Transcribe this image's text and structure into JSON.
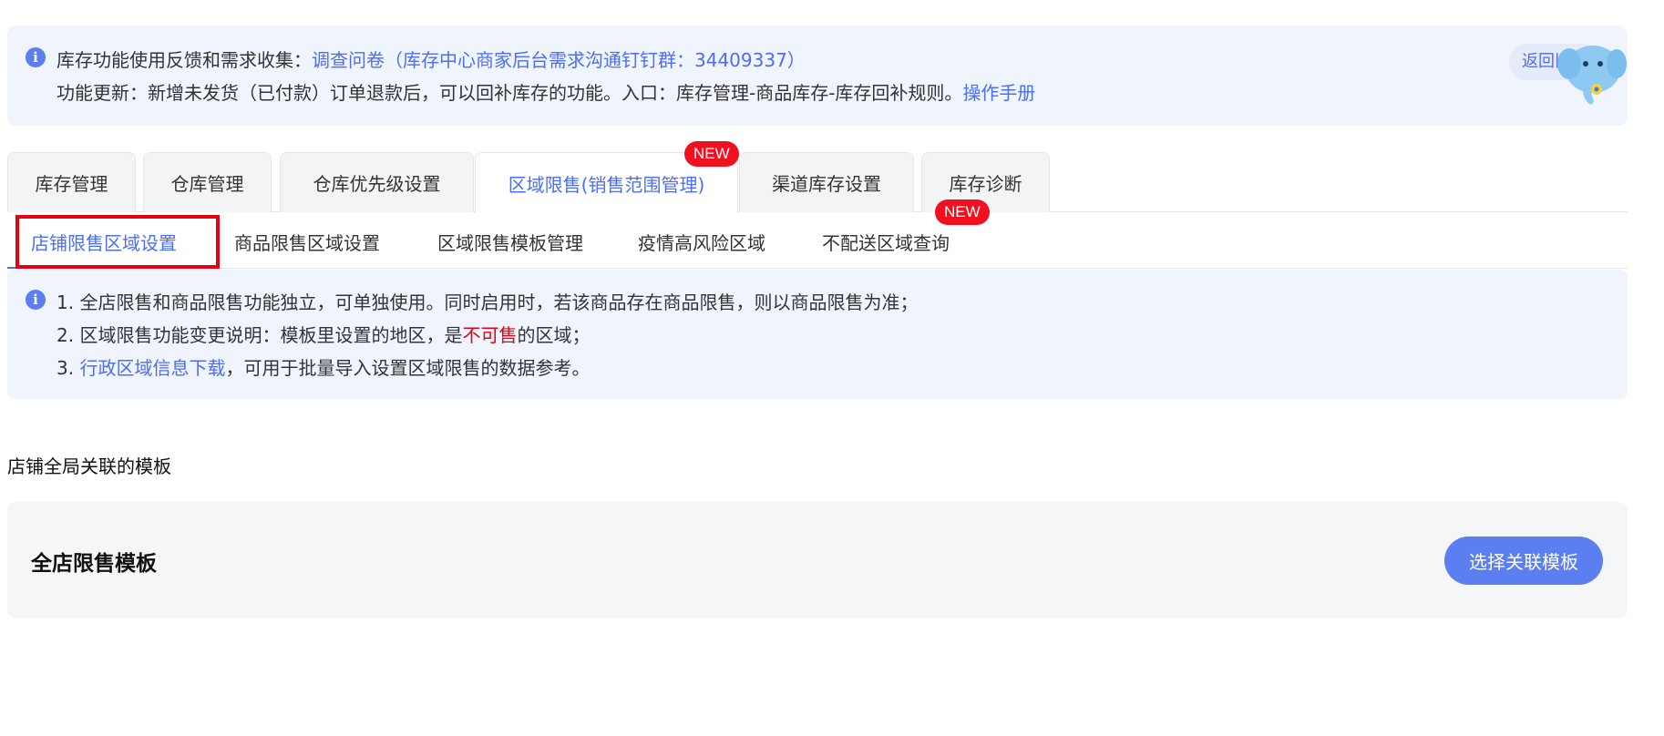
{
  "notice": {
    "line1_prefix": "库存功能使用反馈和需求收集：",
    "line1_link": "调查问卷（库存中心商家后台需求沟通钉钉群：34409337）",
    "line2_text": "功能更新：新增未发货（已付款）订单退款后，可以回补库存的功能。入口：库存管理-商品库存-库存回补规则。",
    "line2_link": "操作手册",
    "old_version_label": "返回旧版"
  },
  "tabs": [
    {
      "label": "库存管理",
      "active": false
    },
    {
      "label": "仓库管理",
      "active": false
    },
    {
      "label": "仓库优先级设置",
      "active": false
    },
    {
      "label": "区域限售(销售范围管理)",
      "active": true,
      "badge": "NEW"
    },
    {
      "label": "渠道库存设置",
      "active": false
    },
    {
      "label": "库存诊断",
      "active": false
    }
  ],
  "subtabs": [
    {
      "label": "店铺限售区域设置",
      "active": true
    },
    {
      "label": "商品限售区域设置",
      "active": false
    },
    {
      "label": "区域限售模板管理",
      "active": false
    },
    {
      "label": "疫情高风险区域",
      "active": false
    },
    {
      "label": "不配送区域查询",
      "active": false,
      "badge": "NEW"
    }
  ],
  "rules": {
    "line1": "1. 全店限售和商品限售功能独立，可单独使用。同时启用时，若该商品存在商品限售，则以商品限售为准；",
    "line2_prefix": "2. 区域限售功能变更说明：模板里设置的地区，是",
    "line2_highlight": "不可售",
    "line2_suffix": "的区域；",
    "line3_prefix": "3. ",
    "line3_link": "行政区域信息下载",
    "line3_suffix": "，可用于批量导入设置区域限售的数据参考。"
  },
  "section": {
    "title": "店铺全局关联的模板",
    "template_name": "全店限售模板",
    "select_button": "选择关联模板"
  },
  "colors": {
    "accent": "#4c6ef5",
    "button": "#5b7ef0",
    "badge": "#f0101e",
    "highlight_box": "#e60012",
    "notice_bg": "#f0f4fd"
  }
}
